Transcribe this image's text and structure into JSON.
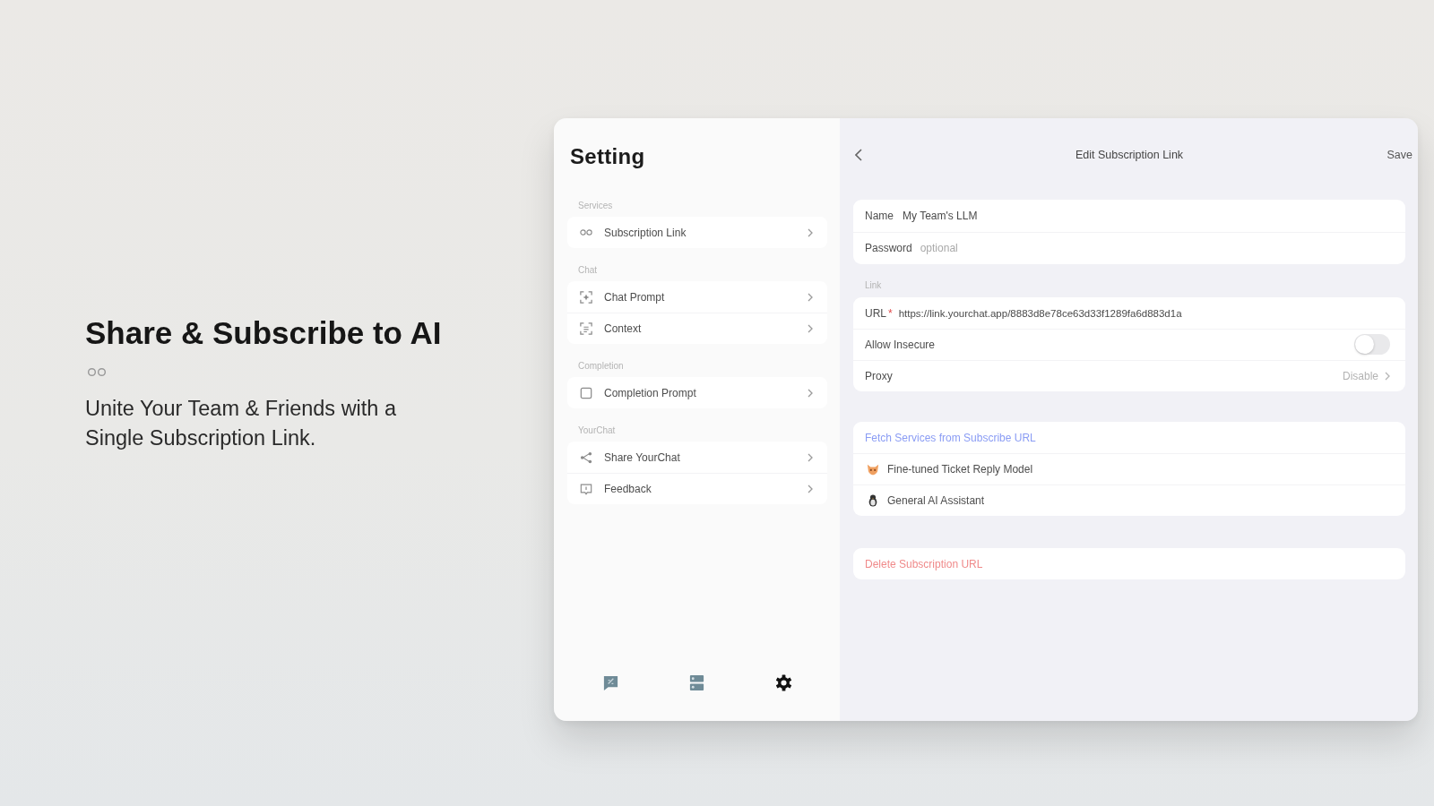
{
  "hero": {
    "title": "Share & Subscribe to AI",
    "subtitle": "Unite Your Team & Friends with a Single Subscription Link."
  },
  "sidebar": {
    "title": "Setting",
    "sections": [
      {
        "label": "Services",
        "items": [
          "Subscription Link"
        ]
      },
      {
        "label": "Chat",
        "items": [
          "Chat Prompt",
          "Context"
        ]
      },
      {
        "label": "Completion",
        "items": [
          "Completion Prompt"
        ]
      },
      {
        "label": "YourChat",
        "items": [
          "Share YourChat",
          "Feedback"
        ]
      }
    ]
  },
  "tab_bar": [
    {
      "selected": false
    },
    {
      "selected": false
    },
    {
      "selected": true
    }
  ],
  "editor": {
    "title": "Edit Subscription Link",
    "save": "Save",
    "account": [
      {
        "label": "Name",
        "value": "My Team's LLM"
      },
      {
        "label": "Password",
        "placeholder": "optional"
      }
    ],
    "link": {
      "label": "Link",
      "url": {
        "label": "URL",
        "required_mark": "*",
        "value": "https://link.yourchat.app/8883d8e78ce63d33f1289fa6d883d1a"
      },
      "allow_insecure": {
        "label": "Allow Insecure",
        "on": false
      },
      "proxy": {
        "label": "Proxy",
        "value": "Disable"
      }
    },
    "services": {
      "fetch": "Fetch Services from Subscribe URL",
      "items": [
        "Fine-tuned Ticket Reply Model",
        "General AI Assistant"
      ]
    },
    "delete": "Delete Subscription URL"
  }
}
